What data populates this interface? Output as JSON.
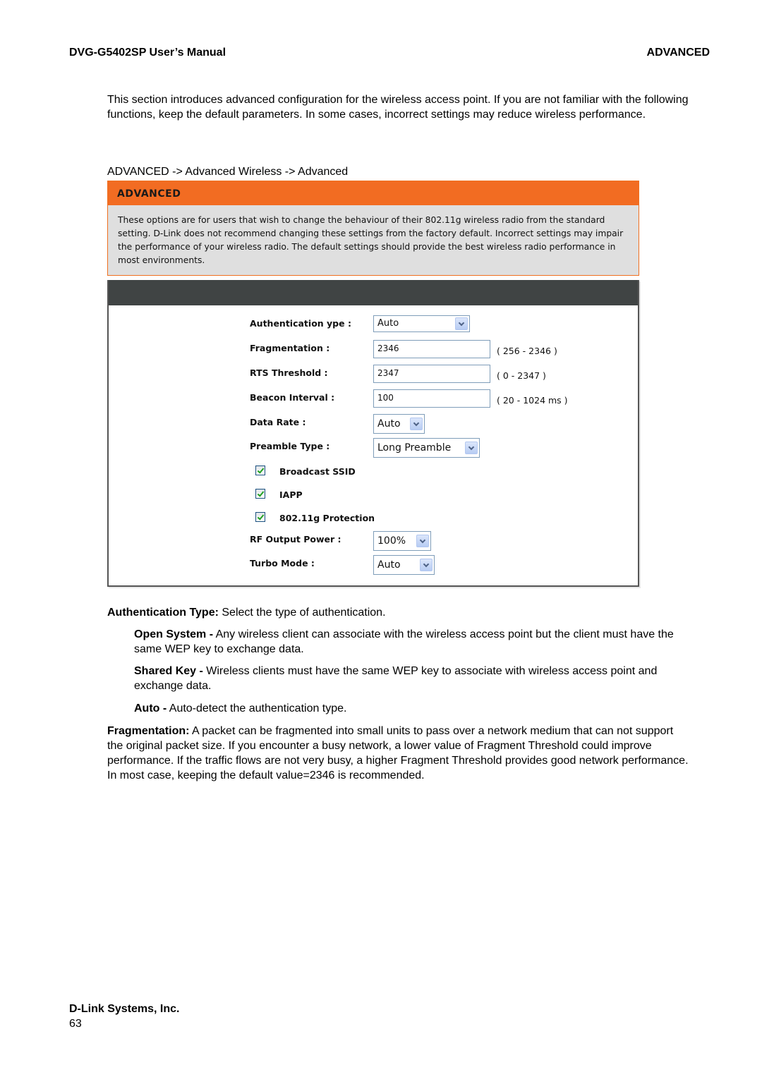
{
  "header": {
    "manual_title": "DVG-G5402SP User’s Manual",
    "section": "ADVANCED"
  },
  "intro": "This section introduces advanced configuration for the wireless access point. If you are not familiar with the following functions, keep the default parameters. In some cases, incorrect settings may reduce wireless performance.",
  "breadcrumb": "ADVANCED -> Advanced Wireless -> Advanced",
  "screenshot": {
    "panel_title": "ADVANCED",
    "panel_description": "These options are for users that wish to change the behaviour of their 802.11g wireless radio from the standard setting. D-Link does not recommend changing these settings from the factory default. Incorrect settings may impair the performance of your wireless radio. The default settings should provide the best wireless radio performance in most environments.",
    "colors": {
      "title_bar": "#f26c22",
      "desc_bg": "#dfdfdf",
      "section_bar": "#404444"
    },
    "fields": {
      "auth_type": {
        "label": "Authentication ype :",
        "value": "Auto"
      },
      "fragmentation": {
        "label": "Fragmentation :",
        "value": "2346",
        "range": "( 256 - 2346 )"
      },
      "rts_threshold": {
        "label": "RTS Threshold :",
        "value": "2347",
        "range": "( 0 - 2347 )"
      },
      "beacon_interval": {
        "label": "Beacon Interval :",
        "value": "100",
        "range": "( 20 - 1024 ms )"
      },
      "data_rate": {
        "label": "Data Rate :",
        "value": "Auto"
      },
      "preamble_type": {
        "label": "Preamble Type :",
        "value": "Long Preamble"
      },
      "broadcast_ssid": {
        "label": "Broadcast SSID",
        "checked": true
      },
      "iapp": {
        "label": "IAPP",
        "checked": true
      },
      "g_protection": {
        "label": "802.11g Protection",
        "checked": true
      },
      "rf_output_power": {
        "label": "RF Output Power :",
        "value": "100%"
      },
      "turbo_mode": {
        "label": "Turbo Mode :",
        "value": "Auto"
      }
    }
  },
  "descriptions": {
    "auth_type": {
      "term": "Authentication Type:",
      "text": " Select the type of authentication."
    },
    "open_system": {
      "term": "Open System -",
      "text": " Any wireless client can associate with the wireless access point but the client must have the same WEP key to exchange data."
    },
    "shared_key": {
      "term": "Shared Key -",
      "text": " Wireless clients must have the same WEP key to associate with wireless access point and exchange data."
    },
    "auto": {
      "term": "Auto -",
      "text": " Auto-detect the authentication type."
    },
    "fragmentation": {
      "term": "Fragmentation:",
      "text": " A packet can be fragmented into small units to pass over a network medium that can not support the original packet size. If you encounter a busy network, a lower value of Fragment Threshold could improve performance. If the traffic flows are not very busy, a higher Fragment Threshold provides good network performance. In most case, keeping the default value=2346 is recommended."
    }
  },
  "footer": {
    "company": "D-Link Systems, Inc.",
    "page_number": "63"
  }
}
